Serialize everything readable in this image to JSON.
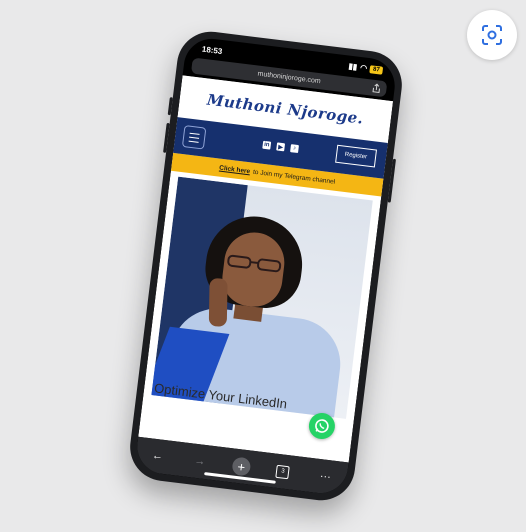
{
  "status": {
    "time": "18:53",
    "battery": "87"
  },
  "browser": {
    "url": "muthoninjoroge.com",
    "tab_count": "3"
  },
  "site": {
    "logo_text": "Muthoni Njoroge.",
    "register_label": "Register",
    "promo": {
      "link_text": "Click here",
      "text": "to Join my Telegram channel"
    },
    "headline": "Optimize Your LinkedIn"
  },
  "icons": [
    "scan-icon",
    "menu-icon",
    "linkedin-icon",
    "youtube-icon",
    "tiktok-icon",
    "whatsapp-icon",
    "share-icon",
    "back-icon",
    "forward-icon",
    "plus-icon",
    "tabs-icon",
    "more-icon"
  ],
  "colors": {
    "brand_blue": "#16306e",
    "promo_yellow": "#f4b614",
    "whatsapp_green": "#25d366"
  }
}
